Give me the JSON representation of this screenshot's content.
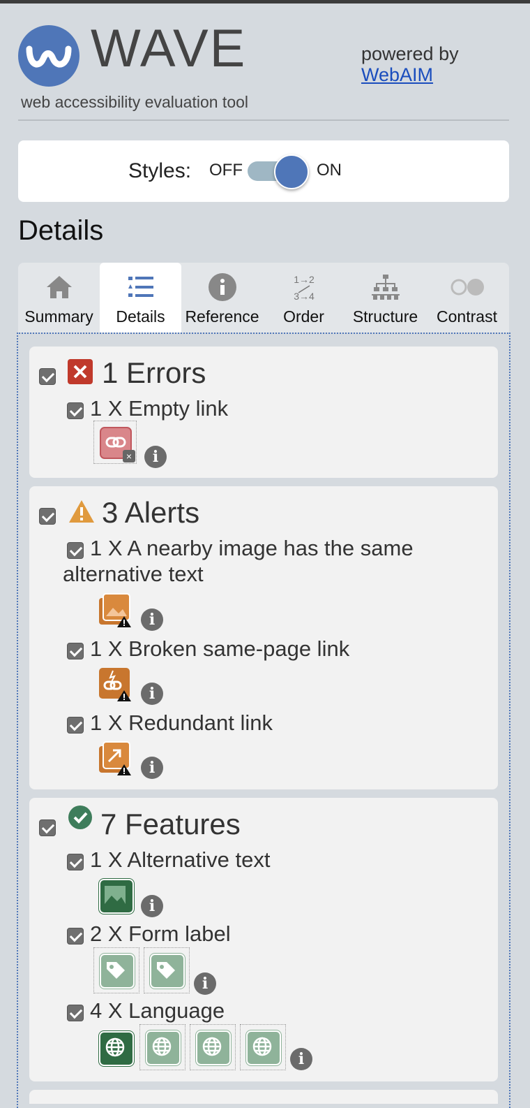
{
  "header": {
    "logo_text": "WAVE",
    "tagline": "web accessibility evaluation tool",
    "powered_by": "powered by",
    "webaim_link": "WebAIM"
  },
  "styles_toggle": {
    "label": "Styles:",
    "off": "OFF",
    "on": "ON",
    "state": "on"
  },
  "section_title": "Details",
  "tabs": [
    {
      "label": "Summary",
      "icon": "home-icon"
    },
    {
      "label": "Details",
      "icon": "list-icon",
      "active": true
    },
    {
      "label": "Reference",
      "icon": "info-icon"
    },
    {
      "label": "Order",
      "icon": "order-icon",
      "icon_text_top": "1→2",
      "icon_text_bottom": "3→4"
    },
    {
      "label": "Structure",
      "icon": "structure-icon"
    },
    {
      "label": "Contrast",
      "icon": "contrast-icon"
    }
  ],
  "groups": {
    "errors": {
      "title": "1 Errors",
      "icon": "error-x-icon",
      "color": "#c0392b",
      "items": [
        {
          "label": "1 X Empty link",
          "icons": [
            "empty-link-icon"
          ]
        }
      ]
    },
    "alerts": {
      "title": "3 Alerts",
      "icon": "alert-triangle-icon",
      "color": "#e09a3e",
      "items": [
        {
          "label_line1": "1 X A nearby image has the same",
          "label_line2": "alternative text",
          "icons": [
            "redundant-alt-icon"
          ]
        },
        {
          "label": "1 X Broken same-page link",
          "icons": [
            "broken-link-icon"
          ]
        },
        {
          "label": "1 X Redundant link",
          "icons": [
            "redundant-link-icon"
          ]
        }
      ]
    },
    "features": {
      "title": "7 Features",
      "icon": "feature-check-icon",
      "color": "#3e7d5b",
      "items": [
        {
          "label": "1 X Alternative text",
          "icons": [
            "alt-text-icon"
          ]
        },
        {
          "label": "2 X Form label",
          "icons": [
            "form-label-icon",
            "form-label-icon"
          ]
        },
        {
          "label": "4 X Language",
          "icons": [
            "language-icon",
            "language-icon",
            "language-icon",
            "language-icon"
          ]
        }
      ]
    }
  },
  "colors": {
    "brand_blue": "#4f76b8",
    "error_red": "#c0392b",
    "alert_orange": "#c8762e",
    "feature_green": "#2f6b43"
  }
}
